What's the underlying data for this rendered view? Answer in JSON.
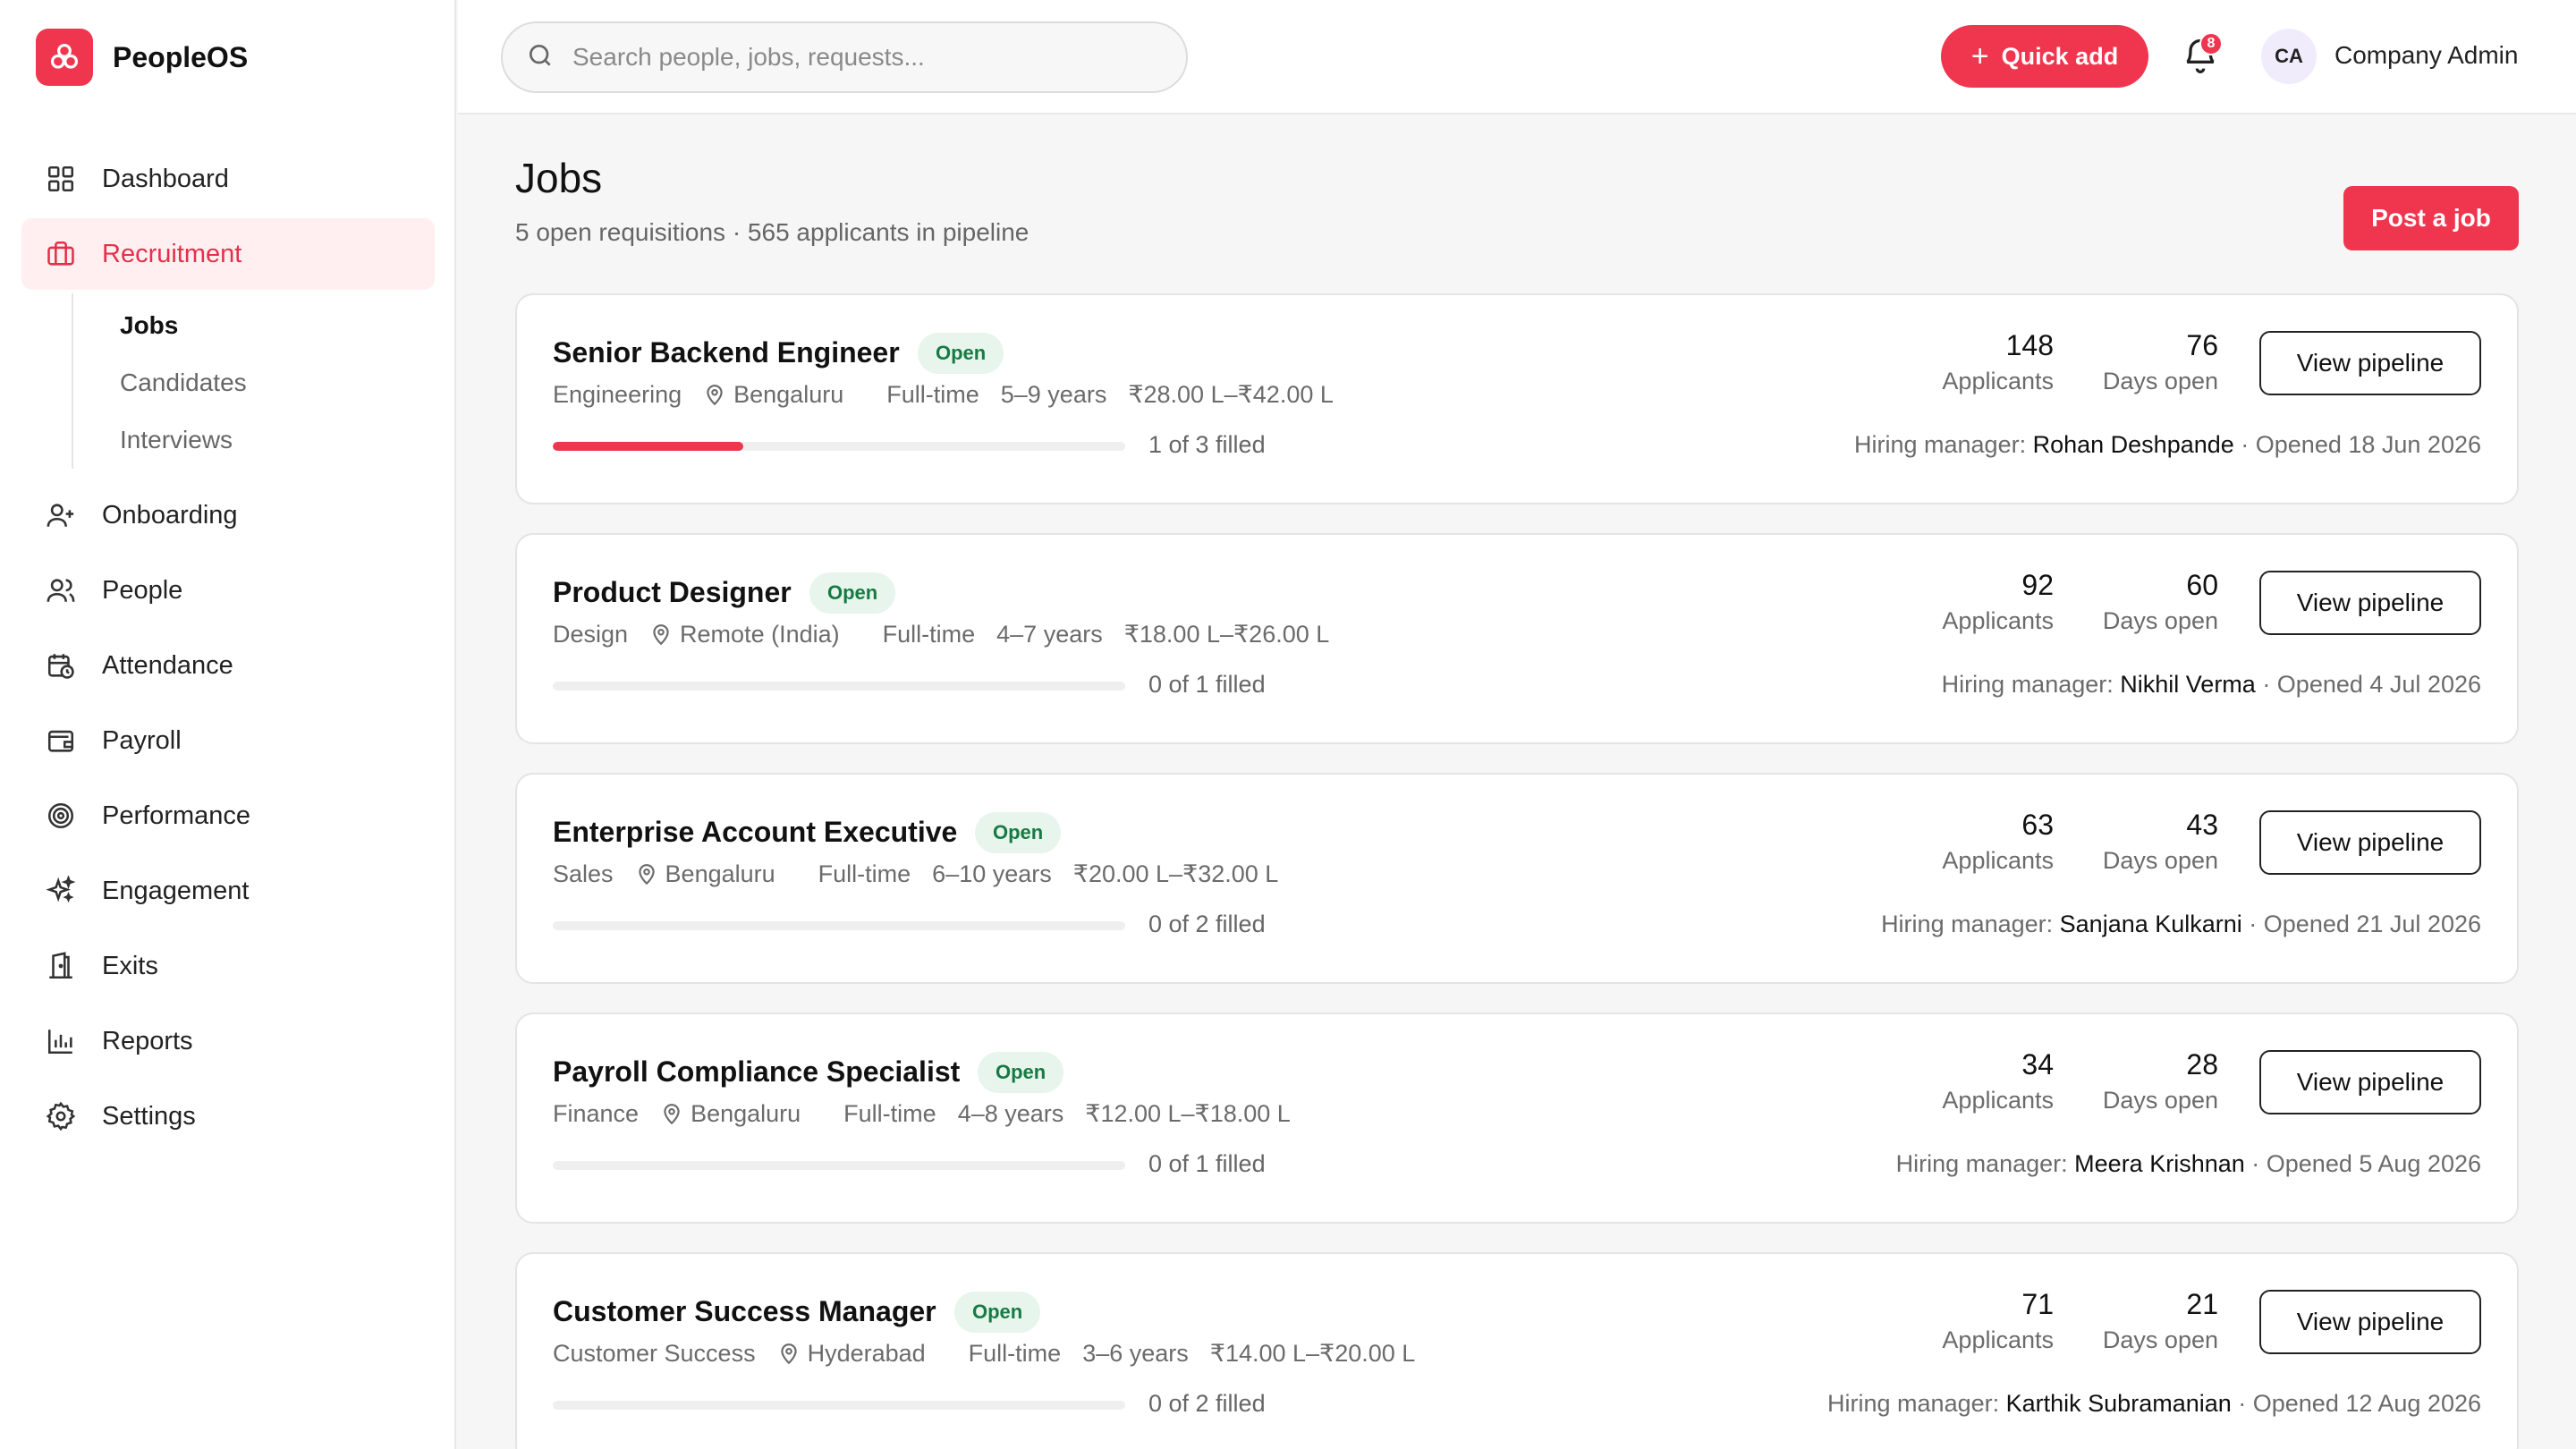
{
  "app": {
    "name": "PeopleOS",
    "logo_icon": "flower-logo-icon",
    "brand_color": "#f0364f"
  },
  "sidebar": {
    "items": [
      {
        "label": "Dashboard",
        "icon": "grid-icon"
      },
      {
        "label": "Recruitment",
        "icon": "briefcase-icon",
        "active": true
      },
      {
        "label": "Onboarding",
        "icon": "user-plus-icon"
      },
      {
        "label": "People",
        "icon": "users-icon"
      },
      {
        "label": "Attendance",
        "icon": "calendar-clock-icon"
      },
      {
        "label": "Payroll",
        "icon": "wallet-icon"
      },
      {
        "label": "Performance",
        "icon": "target-icon"
      },
      {
        "label": "Engagement",
        "icon": "sparkles-icon"
      },
      {
        "label": "Exits",
        "icon": "door-icon"
      },
      {
        "label": "Reports",
        "icon": "bar-chart-icon"
      },
      {
        "label": "Settings",
        "icon": "gear-icon"
      }
    ],
    "subitems": [
      {
        "label": "Jobs",
        "active": true
      },
      {
        "label": "Candidates"
      },
      {
        "label": "Interviews"
      }
    ]
  },
  "topbar": {
    "search_placeholder": "Search people, jobs, requests...",
    "quick_add_label": "Quick add",
    "notification_count": "8",
    "user_initials": "CA",
    "user_name": "Company Admin"
  },
  "page": {
    "title": "Jobs",
    "subtitle": "5 open requisitions · 565 applicants in pipeline",
    "post_job_label": "Post a job"
  },
  "labels": {
    "applicants": "Applicants",
    "days_open": "Days open",
    "view_pipeline": "View pipeline",
    "hiring_manager": "Hiring manager: ",
    "opened_prefix": " · Opened "
  },
  "jobs": [
    {
      "title": "Senior Backend Engineer",
      "status": "Open",
      "department": "Engineering",
      "location": "Bengaluru",
      "type": "Full-time",
      "experience": "5–9 years",
      "salary": "₹28.00 L–₹42.00 L",
      "filled_text": "1 of 3 filled",
      "filled_fraction": 0.333,
      "applicants": "148",
      "days_open": "76",
      "manager": "Rohan Deshpande",
      "opened": "18 Jun 2026"
    },
    {
      "title": "Product Designer",
      "status": "Open",
      "department": "Design",
      "location": "Remote (India)",
      "type": "Full-time",
      "experience": "4–7 years",
      "salary": "₹18.00 L–₹26.00 L",
      "filled_text": "0 of 1 filled",
      "filled_fraction": 0,
      "applicants": "92",
      "days_open": "60",
      "manager": "Nikhil Verma",
      "opened": "4 Jul 2026"
    },
    {
      "title": "Enterprise Account Executive",
      "status": "Open",
      "department": "Sales",
      "location": "Bengaluru",
      "type": "Full-time",
      "experience": "6–10 years",
      "salary": "₹20.00 L–₹32.00 L",
      "filled_text": "0 of 2 filled",
      "filled_fraction": 0,
      "applicants": "63",
      "days_open": "43",
      "manager": "Sanjana Kulkarni",
      "opened": "21 Jul 2026"
    },
    {
      "title": "Payroll Compliance Specialist",
      "status": "Open",
      "department": "Finance",
      "location": "Bengaluru",
      "type": "Full-time",
      "experience": "4–8 years",
      "salary": "₹12.00 L–₹18.00 L",
      "filled_text": "0 of 1 filled",
      "filled_fraction": 0,
      "applicants": "34",
      "days_open": "28",
      "manager": "Meera Krishnan",
      "opened": "5 Aug 2026"
    },
    {
      "title": "Customer Success Manager",
      "status": "Open",
      "department": "Customer Success",
      "location": "Hyderabad",
      "type": "Full-time",
      "experience": "3–6 years",
      "salary": "₹14.00 L–₹20.00 L",
      "filled_text": "0 of 2 filled",
      "filled_fraction": 0,
      "applicants": "71",
      "days_open": "21",
      "manager": "Karthik Subramanian",
      "opened": "12 Aug 2026"
    }
  ]
}
